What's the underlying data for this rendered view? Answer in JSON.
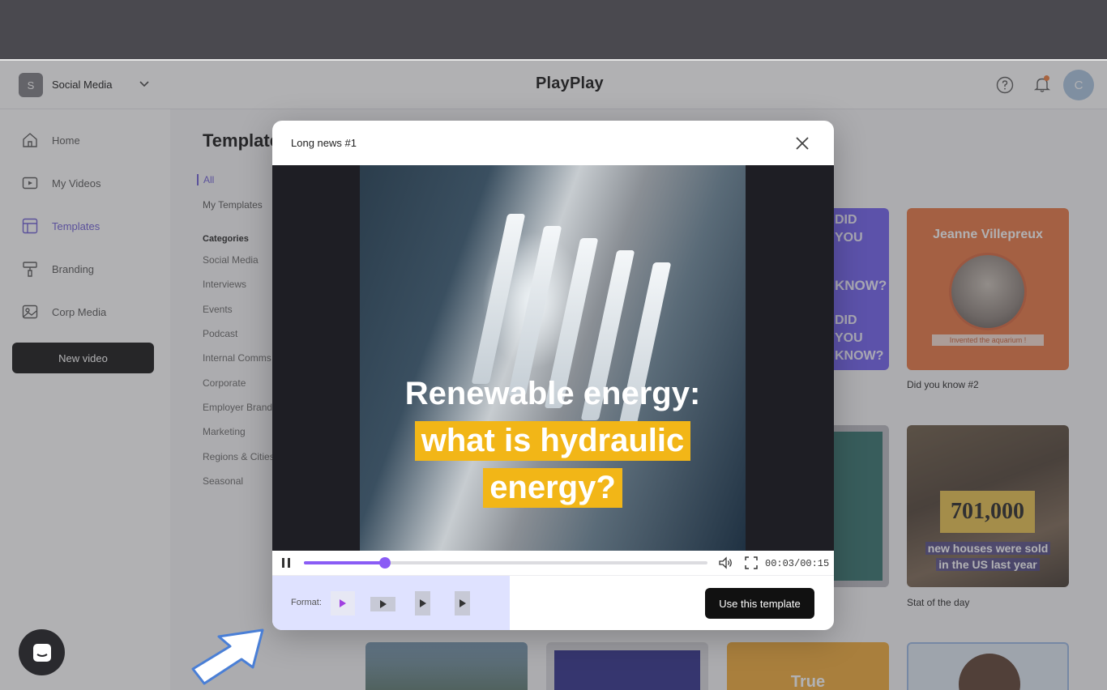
{
  "header": {
    "workspace_initial": "S",
    "workspace_name": "Social Media",
    "logo": "PlayPlay",
    "avatar_initial": "C"
  },
  "sidebar": {
    "items": [
      {
        "label": "Home",
        "icon": "home-icon"
      },
      {
        "label": "My Videos",
        "icon": "video-icon"
      },
      {
        "label": "Templates",
        "icon": "templates-icon"
      },
      {
        "label": "Branding",
        "icon": "paint-roller-icon"
      },
      {
        "label": "Corp Media",
        "icon": "image-icon"
      }
    ],
    "new_video_label": "New video"
  },
  "templates_page": {
    "title": "Templates",
    "tab_all": "All",
    "tab_mine": "My Templates",
    "categories_heading": "Categories",
    "categories": [
      "Social Media",
      "Interviews",
      "Events",
      "Podcast",
      "Internal Comms",
      "Corporate",
      "Employer Branding",
      "Marketing",
      "Regions & Cities",
      "Seasonal"
    ]
  },
  "cards": {
    "did_you_know": {
      "title": "Jeanne Villepreux",
      "tag": "Invented the aquarium !",
      "caption": "Did you know #2"
    },
    "purple_words": [
      "DID",
      "YOU",
      "KNOW?",
      "DID",
      "YOU",
      "KNOW?"
    ],
    "stat_of_day": {
      "number": "701,000",
      "line1": "new houses were sold",
      "line2": "in the US last year",
      "caption": "Stat of the day"
    },
    "bottom_true": "True"
  },
  "modal": {
    "title": "Long news #1",
    "video": {
      "line1": "Renewable energy:",
      "line2": "what is hydraulic",
      "line3": "energy?"
    },
    "player": {
      "timecode": "00:03/00:15",
      "progress": 0.2
    },
    "format_label": "Format:",
    "formats": [
      "square",
      "landscape",
      "portrait",
      "story"
    ],
    "use_template_label": "Use this template"
  },
  "colors": {
    "accent": "#8a5cf5",
    "highlight": "#f2b617",
    "dark_button": "#111111"
  }
}
